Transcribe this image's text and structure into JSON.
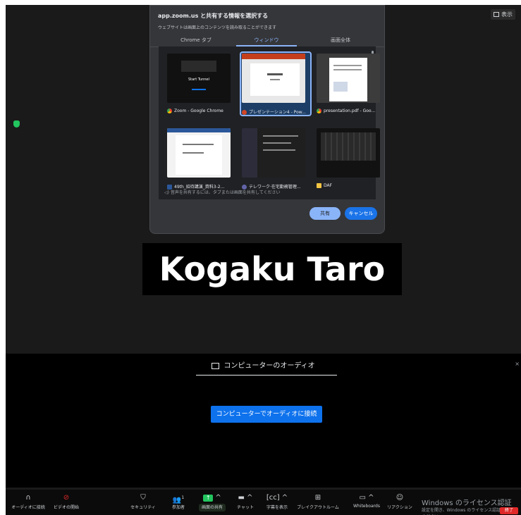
{
  "app": {
    "view_label": "表示"
  },
  "share_dialog": {
    "title": "app.zoom.us と共有する情報を選択する",
    "subtitle": "ウェブサイトは画面上のコンテンツを読み取ることができます",
    "tabs": [
      {
        "label": "Chrome タブ"
      },
      {
        "label": "ウィンドウ"
      },
      {
        "label": "画面全体"
      }
    ],
    "active_tab": "ウィンドウ",
    "windows": [
      {
        "label": "Zoom - Google Chrome",
        "icon": "chrome-icon"
      },
      {
        "label": "プレゼンテーション4 - Pow...",
        "icon": "powerpoint-icon"
      },
      {
        "label": "presentation.pdf - Goo...",
        "icon": "chrome-icon"
      },
      {
        "label": "49th_招待講演_資料3-2...",
        "icon": "word-icon"
      },
      {
        "label": "テレワーク·在宅勤務管理...",
        "icon": "teams-icon"
      },
      {
        "label": "DAF",
        "icon": "folder-icon"
      }
    ],
    "thumb_texts": {
      "zoom_start": "Start Tunnel"
    },
    "selected_window": "プレゼンテーション4 - Pow...",
    "audio_hint": "音声を共有するには、タブまたは画面を共有してください",
    "share_button": "共有",
    "cancel_button": "キャンセル"
  },
  "participant": {
    "name": "Kogaku Taro"
  },
  "audio_panel": {
    "title": "コンピューターのオーディオ",
    "join_button": "コンピューターでオーディオに接続"
  },
  "toolbar": {
    "items": [
      {
        "label": "オーディオに接続",
        "icon": "headphones-icon"
      },
      {
        "label": "ビデオの開始",
        "icon": "video-off-icon"
      },
      {
        "label": "セキュリティ",
        "icon": "shield-icon"
      },
      {
        "label": "参加者",
        "icon": "participants-icon",
        "count": "1"
      },
      {
        "label": "画面の共有",
        "icon": "share-screen-icon"
      },
      {
        "label": "チャット",
        "icon": "chat-icon"
      },
      {
        "label": "字幕を表示",
        "icon": "cc-icon"
      },
      {
        "label": "ブレイクアウトルーム",
        "icon": "breakout-icon"
      },
      {
        "label": "Whiteboards",
        "icon": "whiteboard-icon"
      },
      {
        "label": "リアクション",
        "icon": "reaction-icon"
      }
    ],
    "end_button": "終了"
  },
  "watermark": {
    "line1": "Windows のライセンス認証",
    "line2": "設定を開き、Windows のライセンス認証を行ってください。"
  },
  "colors": {
    "accent_blue": "#8ab4f8",
    "zoom_blue": "#0e72ed",
    "share_green": "#22c55e",
    "end_red": "#e02828"
  }
}
